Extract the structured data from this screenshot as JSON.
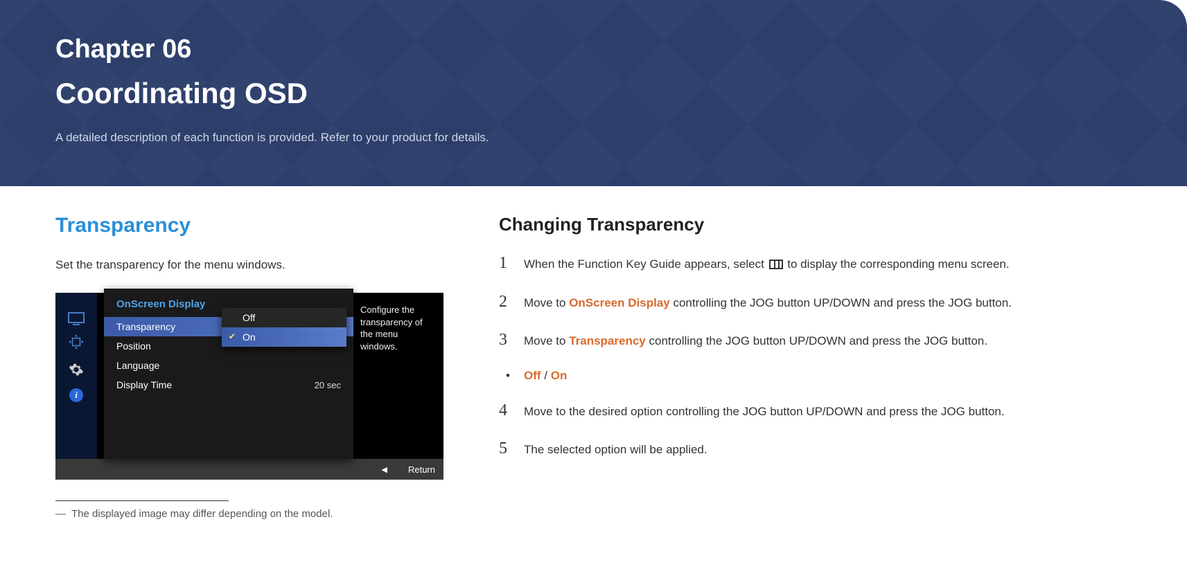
{
  "banner": {
    "chapter": "Chapter  06",
    "title": "Coordinating OSD",
    "desc": "A detailed description of each function is provided. Refer to your product for details."
  },
  "left": {
    "heading": "Transparency",
    "intro": "Set the transparency for the menu windows.",
    "footnote": "The displayed image may differ depending on the model."
  },
  "osd": {
    "menu_title": "OnScreen Display",
    "items": [
      {
        "label": "Transparency",
        "value": "",
        "selected": true
      },
      {
        "label": "Position",
        "value": "",
        "selected": false
      },
      {
        "label": "Language",
        "value": "",
        "selected": false
      },
      {
        "label": "Display Time",
        "value": "20 sec",
        "selected": false
      }
    ],
    "dropdown": [
      {
        "label": "Off",
        "selected": false
      },
      {
        "label": "On",
        "selected": true
      }
    ],
    "help": "Configure the transparency of the menu windows.",
    "footer_return": "Return"
  },
  "right": {
    "heading": "Changing Transparency",
    "steps": {
      "s1a": "When the Function Key Guide appears, select ",
      "s1b": " to display the corresponding menu screen.",
      "s2a": "Move to ",
      "s2b": "OnScreen Display",
      "s2c": " controlling the JOG button UP/DOWN and press the JOG button.",
      "s3a": "Move to ",
      "s3b": "Transparency",
      "s3c": " controlling the JOG button UP/DOWN and press the JOG button.",
      "opt_off": "Off",
      "opt_sep": " / ",
      "opt_on": "On",
      "s4": "Move to the desired option controlling the JOG button UP/DOWN and press the JOG button.",
      "s5": "The selected option will be applied."
    },
    "nums": {
      "n1": "1",
      "n2": "2",
      "n3": "3",
      "n4": "4",
      "n5": "5",
      "bullet": "•"
    }
  }
}
